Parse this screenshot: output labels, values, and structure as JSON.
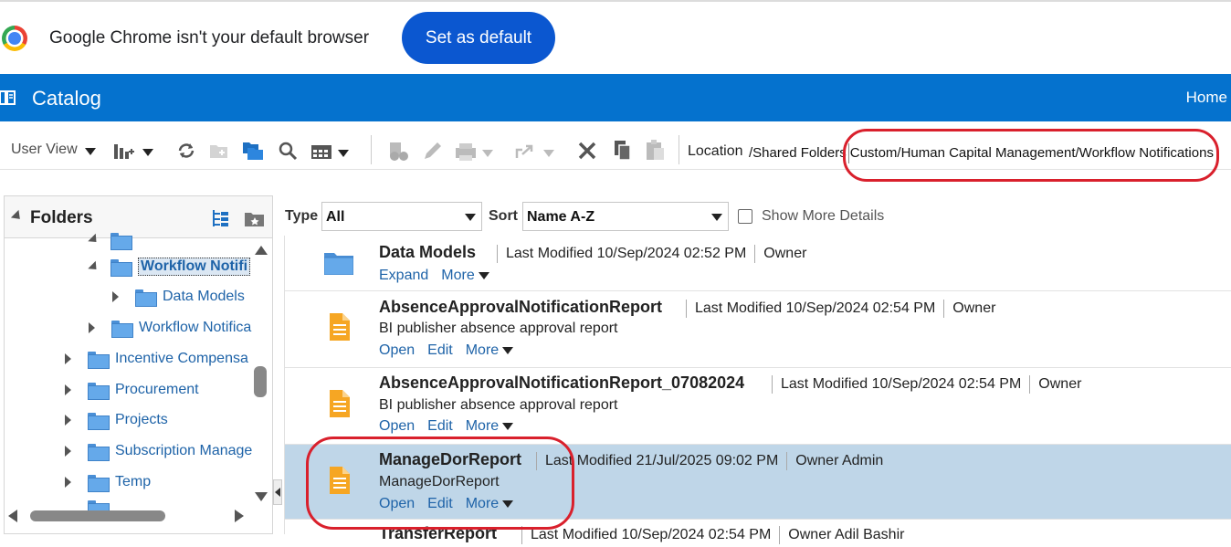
{
  "banner": {
    "message": "Google Chrome isn't your default browser",
    "button": "Set as default"
  },
  "header": {
    "title": "Catalog",
    "home": "Home"
  },
  "toolbar": {
    "user_view": "User View",
    "location_label": "Location",
    "location_prefix": "/Shared Folders",
    "location_path": "Custom/Human Capital Management/Workflow Notifications"
  },
  "folders": {
    "title": "Folders",
    "items": [
      {
        "label": "Workflow Notifi"
      },
      {
        "label": "Data Models"
      },
      {
        "label": "Workflow Notifica"
      },
      {
        "label": "Incentive Compensa"
      },
      {
        "label": "Procurement"
      },
      {
        "label": "Projects"
      },
      {
        "label": "Subscription Manage"
      },
      {
        "label": "Temp"
      }
    ]
  },
  "filters": {
    "type_label": "Type",
    "type_value": "All",
    "sort_label": "Sort",
    "sort_value": "Name A-Z",
    "details_label": "Show More Details"
  },
  "items": [
    {
      "name": "Data Models",
      "modified": "Last Modified 10/Sep/2024 02:52 PM",
      "owner": "Owner",
      "description": "",
      "actions": [
        "Expand",
        "More"
      ]
    },
    {
      "name": "AbsenceApprovalNotificationReport",
      "modified": "Last Modified 10/Sep/2024 02:54 PM",
      "owner": "Owner",
      "description": "BI publisher absence approval report",
      "actions": [
        "Open",
        "Edit",
        "More"
      ]
    },
    {
      "name": "AbsenceApprovalNotificationReport_07082024",
      "modified": "Last Modified 10/Sep/2024 02:54 PM",
      "owner": "Owner",
      "description": "BI publisher absence approval report",
      "actions": [
        "Open",
        "Edit",
        "More"
      ]
    },
    {
      "name": "ManageDorReport",
      "modified": "Last Modified 21/Jul/2025 09:02 PM",
      "owner": "Owner Admin",
      "description": "ManageDorReport",
      "actions": [
        "Open",
        "Edit",
        "More"
      ]
    },
    {
      "name": "TransferReport",
      "modified": "Last Modified 10/Sep/2024 02:54 PM",
      "owner": "Owner Adil Bashir",
      "description": "",
      "actions": []
    }
  ],
  "colors": {
    "header_blue": "#0572ce",
    "chrome_button": "#0b57d0",
    "selected_row": "#bfd6e8",
    "annotation_red": "#d9202c",
    "link_blue": "#1e63a8",
    "doc_orange": "#f6a623"
  }
}
